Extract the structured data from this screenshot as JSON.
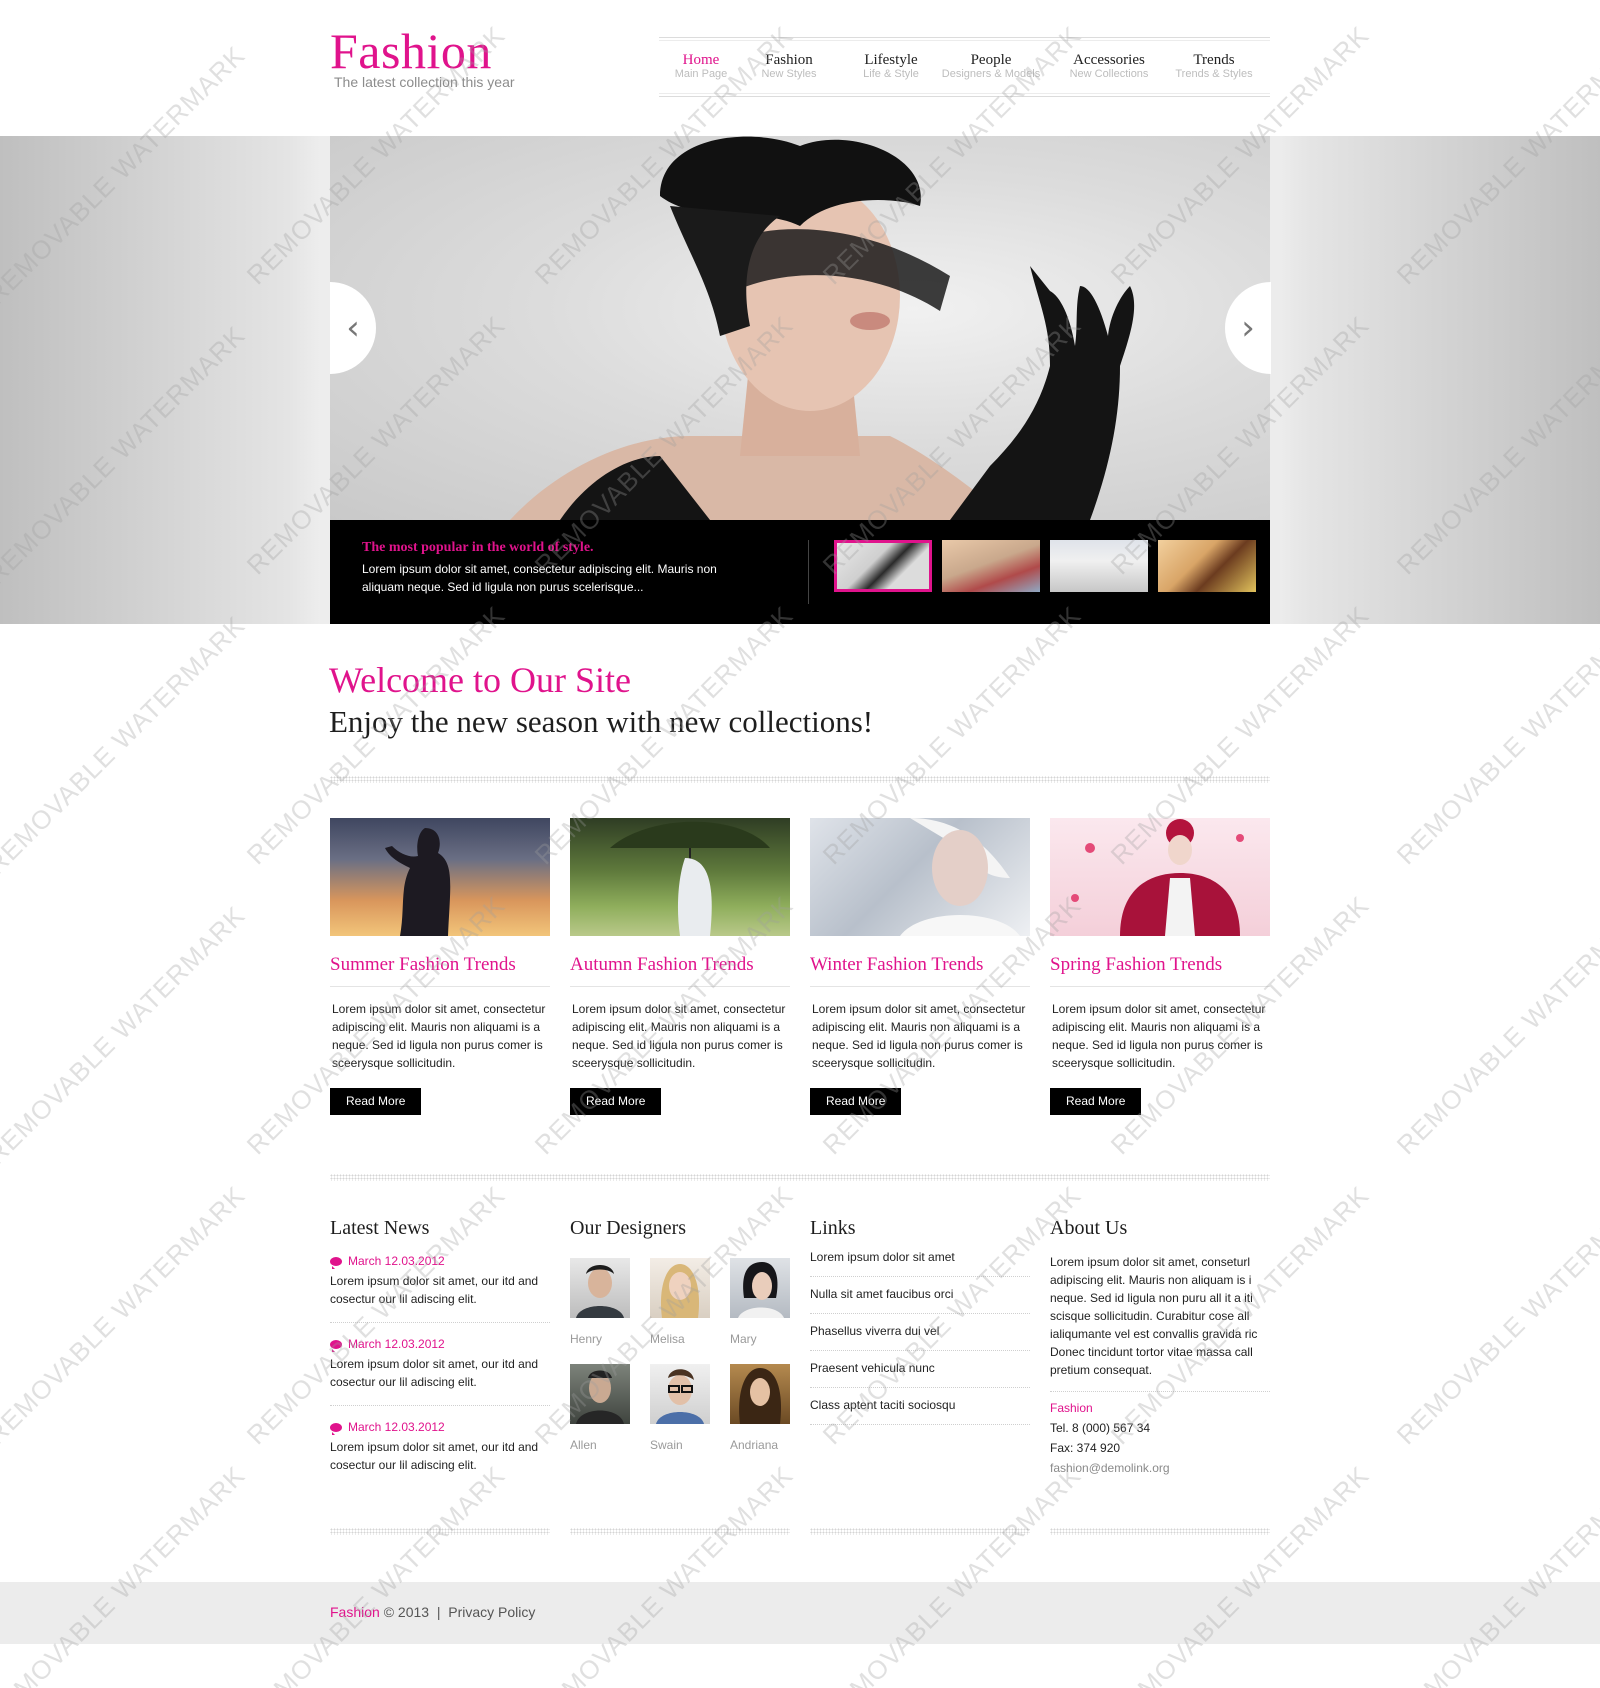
{
  "brand": {
    "name": "Fashion",
    "tagline": "The latest collection this year"
  },
  "colors": {
    "accent": "#e0138c",
    "dark": "#000000",
    "text": "#222222"
  },
  "nav": [
    {
      "label": "Home",
      "sub": "Main Page",
      "active": true
    },
    {
      "label": "Fashion",
      "sub": "New Styles"
    },
    {
      "label": "Lifestyle",
      "sub": "Life & Style"
    },
    {
      "label": "People",
      "sub": "Designers & Models"
    },
    {
      "label": "Accessories",
      "sub": "New Collections"
    },
    {
      "label": "Trends",
      "sub": "Trends & Styles"
    }
  ],
  "slider": {
    "caption_title": "The most popular in the world of style.",
    "caption_text": "Lorem ipsum dolor sit amet, consectetur adipiscing elit. Mauris non aliquam neque. Sed id ligula non purus scelerisque...",
    "prev_icon": "chevron-left-icon",
    "next_icon": "chevron-right-icon",
    "thumbnails_count": 4,
    "active_thumbnail": 1
  },
  "welcome": {
    "title": "Welcome to Our Site",
    "subtitle": "Enjoy the new season with new collections!"
  },
  "features": [
    {
      "title": "Summer Fashion Trends",
      "text": "Lorem ipsum dolor sit amet, consectetur adipiscing elit. Mauris non aliquami is a neque. Sed id ligula non purus comer is sceerysque sollicitudin.",
      "button": "Read More"
    },
    {
      "title": "Autumn Fashion Trends",
      "text": "Lorem ipsum dolor sit amet, consectetur adipiscing elit. Mauris non aliquami is a neque. Sed id ligula non purus comer is sceerysque sollicitudin.",
      "button": "Read More"
    },
    {
      "title": "Winter  Fashion Trends",
      "text": "Lorem ipsum dolor sit amet, consectetur adipiscing elit. Mauris non aliquami is a neque. Sed id ligula non purus comer is sceerysque sollicitudin.",
      "button": "Read More"
    },
    {
      "title": "Spring Fashion Trends",
      "text": "Lorem ipsum dolor sit amet, consectetur adipiscing elit. Mauris non aliquami is a neque. Sed id ligula non purus comer is sceerysque sollicitudin.",
      "button": "Read More"
    }
  ],
  "news": {
    "heading": "Latest News",
    "items": [
      {
        "date": "March 12.03.2012",
        "text": "Lorem ipsum dolor sit amet, our itd and cosectur our lil adiscing elit."
      },
      {
        "date": "March 12.03.2012",
        "text": "Lorem ipsum dolor sit amet, our itd and cosectur our lil adiscing elit."
      },
      {
        "date": "March 12.03.2012",
        "text": "Lorem ipsum dolor sit amet, our itd and cosectur our lil adiscing elit."
      }
    ]
  },
  "designers": {
    "heading": "Our Designers",
    "people": [
      "Henry",
      "Melisa",
      "Mary",
      "Allen",
      "Swain",
      "Andriana"
    ]
  },
  "links": {
    "heading": "Links",
    "items": [
      "Lorem ipsum dolor sit amet",
      "Nulla sit amet faucibus orci",
      "Phasellus viverra dui vel",
      "Praesent vehicula nunc",
      "Class aptent taciti sociosqu"
    ]
  },
  "about": {
    "heading": "About Us",
    "text": "Lorem ipsum dolor sit amet, conseturl adipiscing elit. Mauris non aliquam is i neque. Sed id ligula non puru all it  a iti scisque sollicitudin. Curabitur cose all ialiqumante vel est convallis gravida ric Donec tincidunt tortor vitae massa call pretium consequat.",
    "company": "Fashion",
    "tel": "Tel. 8 (000) 567 34",
    "fax": "Fax: 374 920",
    "email": "fashion@demolink.org"
  },
  "footer": {
    "brand": "Fashion",
    "copyright": "© 2013",
    "separator": "|",
    "privacy": "Privacy Policy"
  },
  "watermark": "REMOVABLE WATERMARK"
}
